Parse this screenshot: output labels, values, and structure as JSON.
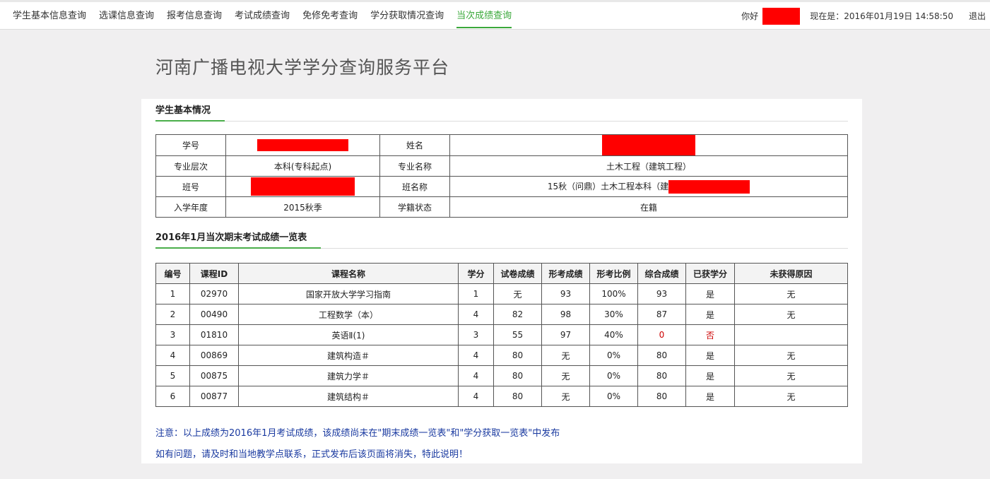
{
  "nav": {
    "items": [
      "学生基本信息查询",
      "选课信息查询",
      "报考信息查询",
      "考试成绩查询",
      "免修免考查询",
      "学分获取情况查询",
      "当次成绩查询"
    ],
    "active_index": 6
  },
  "header": {
    "greeting": "你好",
    "now_label": "现在是：2016年01月19日 14:58:50",
    "logout": "退出"
  },
  "page_title": "河南广播电视大学学分查询服务平台",
  "student": {
    "section_title": "学生基本情况",
    "rows": [
      {
        "l1": "学号",
        "v1": "",
        "l2": "姓名",
        "v2": ""
      },
      {
        "l1": "专业层次",
        "v1": "本科(专科起点)",
        "l2": "专业名称",
        "v2": "土木工程（建筑工程）"
      },
      {
        "l1": "班号",
        "v1": "",
        "l2": "班名称",
        "v2": "15秋（问鼎）土木工程本科（建"
      },
      {
        "l1": "入学年度",
        "v1": "2015秋季",
        "l2": "学籍状态",
        "v2": "在籍"
      }
    ]
  },
  "grades": {
    "section_title": "2016年1月当次期末考试成绩一览表",
    "headers": [
      "编号",
      "课程ID",
      "课程名称",
      "学分",
      "试卷成绩",
      "形考成绩",
      "形考比例",
      "综合成绩",
      "已获学分",
      "未获得原因"
    ],
    "rows": [
      [
        "1",
        "02970",
        "国家开放大学学习指南",
        "1",
        "无",
        "93",
        "100%",
        "93",
        "是",
        "无"
      ],
      [
        "2",
        "00490",
        "工程数学（本）",
        "4",
        "82",
        "98",
        "30%",
        "87",
        "是",
        "无"
      ],
      [
        "3",
        "01810",
        "英语Ⅱ(1)",
        "3",
        "55",
        "97",
        "40%",
        "0",
        "否",
        ""
      ],
      [
        "4",
        "00869",
        "建筑构造＃",
        "4",
        "80",
        "无",
        "0%",
        "80",
        "是",
        "无"
      ],
      [
        "5",
        "00875",
        "建筑力学＃",
        "4",
        "80",
        "无",
        "0%",
        "80",
        "是",
        "无"
      ],
      [
        "6",
        "00877",
        "建筑结构＃",
        "4",
        "80",
        "无",
        "0%",
        "80",
        "是",
        "无"
      ]
    ]
  },
  "notice": {
    "line1": "注意：以上成绩为2016年1月考试成绩，该成绩尚未在\"期末成绩一览表\"和\"学分获取一览表\"中发布",
    "line2": "如有问题，请及时和当地教学点联系，正式发布后该页面将消失，特此说明！"
  },
  "colors": {
    "accent": "#3aa83a",
    "redaction": "#ff0000",
    "notice": "#1a3aa0",
    "fail": "#cc0000"
  }
}
